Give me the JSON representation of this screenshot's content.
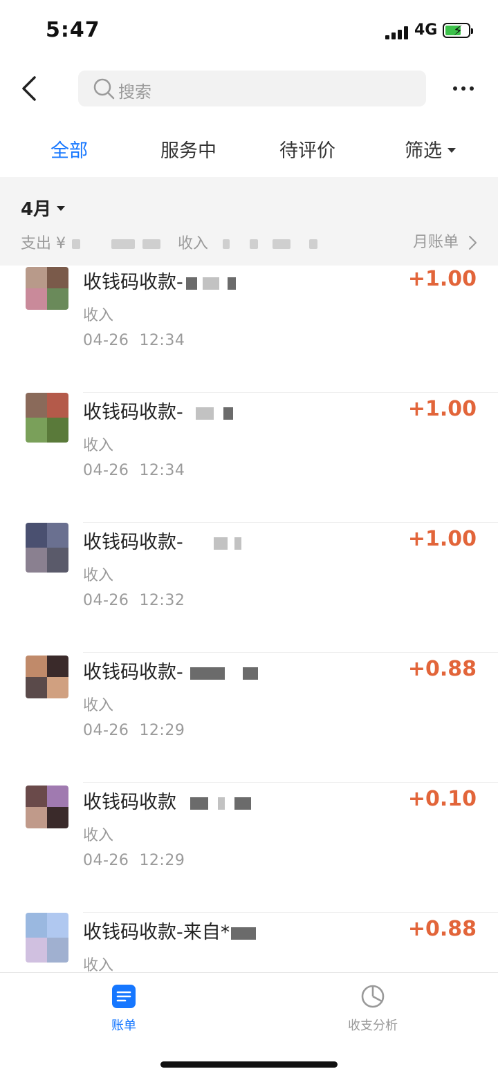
{
  "status_bar": {
    "time": "5:47",
    "network": "4G",
    "battery_color": "#3cc14a"
  },
  "nav": {
    "search_placeholder": "搜索",
    "back_icon": "chevron-left-icon",
    "more_icon": "more-dots-icon"
  },
  "tabs": [
    {
      "label": "全部",
      "active": true
    },
    {
      "label": "服务中",
      "active": false
    },
    {
      "label": "待评价",
      "active": false
    },
    {
      "label": "筛选",
      "active": false
    }
  ],
  "month": {
    "title": "4月",
    "expense_label": "支出 ¥",
    "income_label": "收入",
    "monthly_bill": "月账单"
  },
  "records": [
    {
      "title": "收钱码收款-",
      "type": "收入",
      "date": "04-26",
      "time": "12:34",
      "amount": "+1.00"
    },
    {
      "title": "收钱码收款-",
      "type": "收入",
      "date": "04-26",
      "time": "12:34",
      "amount": "+1.00"
    },
    {
      "title": "收钱码收款-",
      "type": "收入",
      "date": "04-26",
      "time": "12:32",
      "amount": "+1.00"
    },
    {
      "title": "收钱码收款-",
      "type": "收入",
      "date": "04-26",
      "time": "12:29",
      "amount": "+0.88"
    },
    {
      "title": "收钱码收款",
      "type": "收入",
      "date": "04-26",
      "time": "12:29",
      "amount": "+0.10"
    },
    {
      "title": "收钱码收款-来自*",
      "type": "收入",
      "date": "",
      "time": "",
      "amount": "+0.88"
    }
  ],
  "bottom_tabs": [
    {
      "label": "账单",
      "icon": "bill-list-icon",
      "active": true
    },
    {
      "label": "收支分析",
      "icon": "pie-chart-icon",
      "active": false
    }
  ],
  "colors": {
    "accent": "#1677ff",
    "income": "#e2653a",
    "muted": "#9a9a9a"
  }
}
